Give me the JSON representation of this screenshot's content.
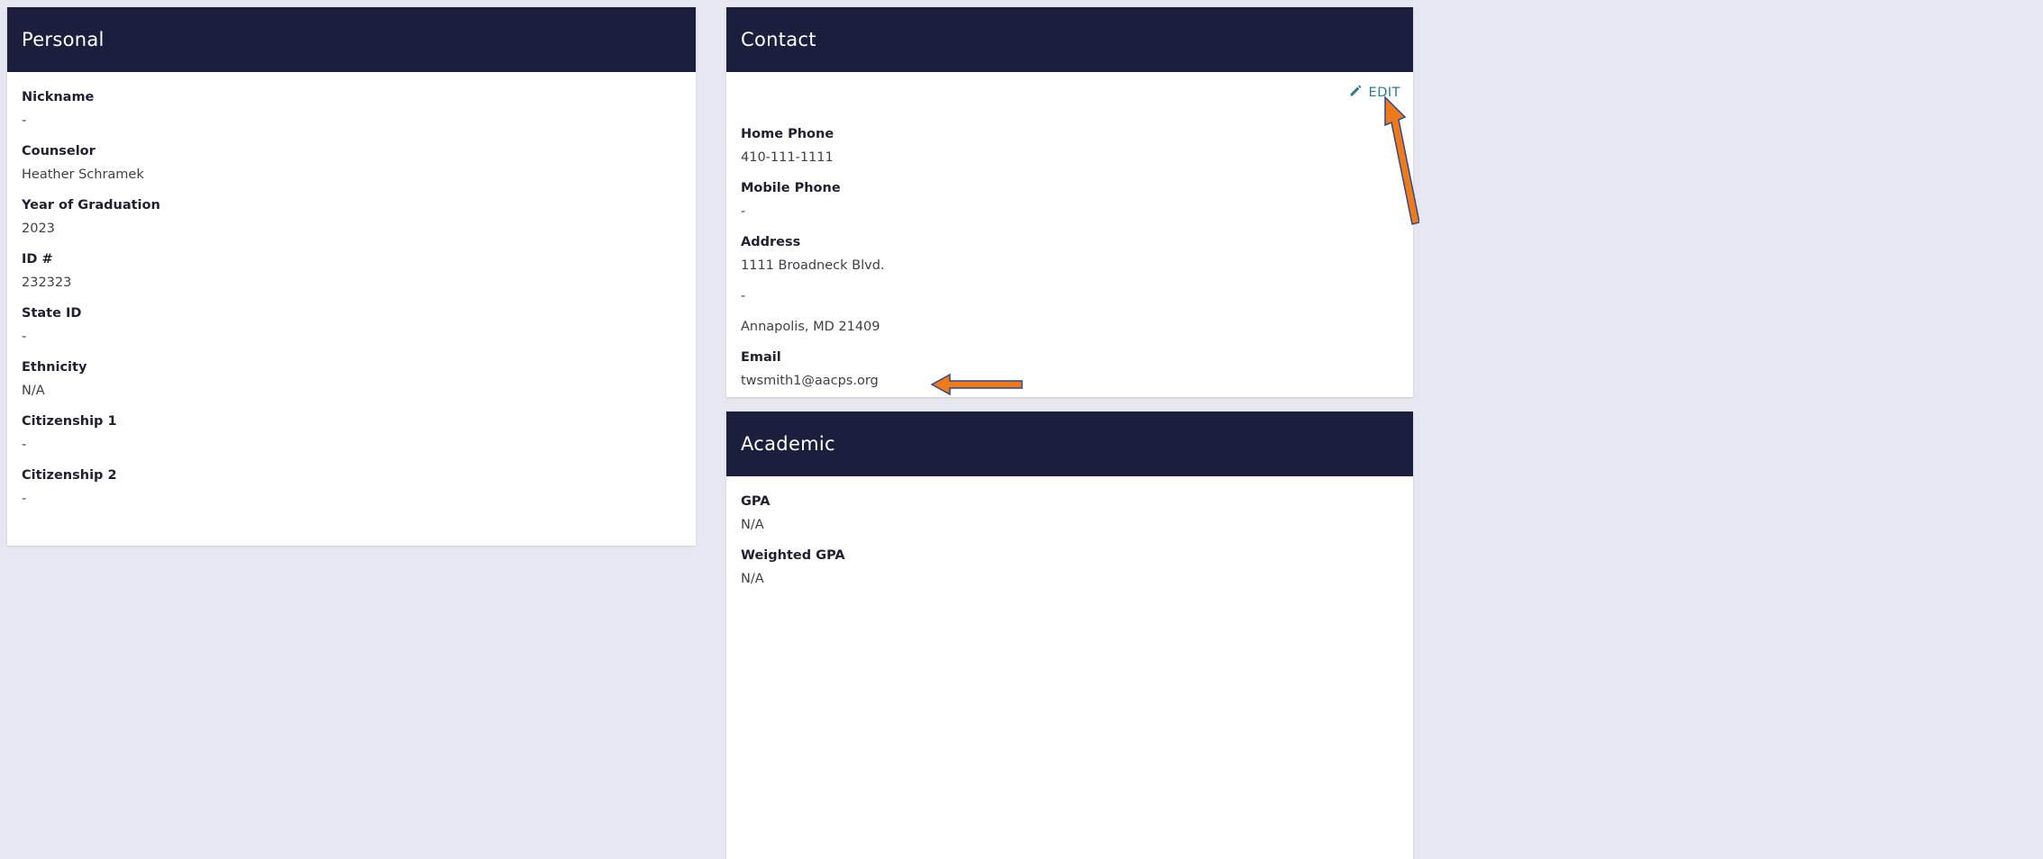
{
  "personal": {
    "title": "Personal",
    "fields": [
      {
        "label": "Nickname",
        "value": "-"
      },
      {
        "label": "Counselor",
        "value": "Heather Schramek"
      },
      {
        "label": "Year of Graduation",
        "value": "2023"
      },
      {
        "label": "ID #",
        "value": "232323"
      },
      {
        "label": "State ID",
        "value": "-"
      },
      {
        "label": "Ethnicity",
        "value": "N/A"
      },
      {
        "label": "Citizenship 1",
        "value": "-"
      },
      {
        "label": "Citizenship 2",
        "value": "-"
      }
    ]
  },
  "contact": {
    "title": "Contact",
    "edit_label": "EDIT",
    "edit_icon": "pencil-icon",
    "home_phone": {
      "label": "Home Phone",
      "value": "410-111-1111"
    },
    "mobile_phone": {
      "label": "Mobile Phone",
      "value": "-"
    },
    "address": {
      "label": "Address",
      "line1": "1111 Broadneck Blvd.",
      "line2": "-",
      "line3": "Annapolis, MD 21409"
    },
    "email": {
      "label": "Email",
      "value": "twsmith1@aacps.org"
    }
  },
  "academic": {
    "title": "Academic",
    "fields": [
      {
        "label": "GPA",
        "value": "N/A"
      },
      {
        "label": "Weighted GPA",
        "value": "N/A"
      }
    ]
  },
  "colors": {
    "header_bg": "#1c1e3d",
    "page_bg": "#e6e7f1",
    "accent_link": "#2f7a86",
    "annotation_arrow": "#f07a1a"
  }
}
